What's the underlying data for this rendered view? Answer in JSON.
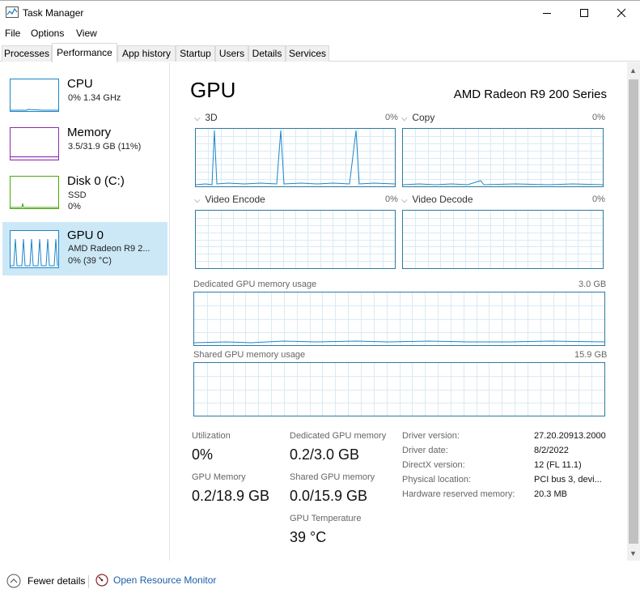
{
  "window": {
    "title": "Task Manager"
  },
  "menu": [
    "File",
    "Options",
    "View"
  ],
  "tabs": [
    "Processes",
    "Performance",
    "App history",
    "Startup",
    "Users",
    "Details",
    "Services"
  ],
  "active_tab": "Performance",
  "resources": [
    {
      "title": "CPU",
      "lines": [
        "0%  1.34 GHz"
      ],
      "color": "#1a86c8"
    },
    {
      "title": "Memory",
      "lines": [
        "3.5/31.9 GB (11%)"
      ],
      "color": "#8b2bad"
    },
    {
      "title": "Disk 0 (C:)",
      "lines": [
        "SSD",
        "0%"
      ],
      "color": "#4da60c"
    },
    {
      "title": "GPU 0",
      "lines": [
        "AMD Radeon R9 2...",
        "0%  (39 °C)"
      ],
      "color": "#1a86c8"
    }
  ],
  "gpu": {
    "title": "GPU",
    "model": "AMD Radeon R9 200 Series",
    "engines": [
      {
        "label": "3D",
        "percent": "0%"
      },
      {
        "label": "Copy",
        "percent": "0%"
      },
      {
        "label": "Video Encode",
        "percent": "0%"
      },
      {
        "label": "Video Decode",
        "percent": "0%"
      }
    ],
    "dedicated_memory_graph": {
      "label": "Dedicated GPU memory usage",
      "max": "3.0 GB"
    },
    "shared_memory_graph": {
      "label": "Shared GPU memory usage",
      "max": "15.9 GB"
    },
    "stats": {
      "utilization": {
        "label": "Utilization",
        "value": "0%"
      },
      "dedicated_memory": {
        "label": "Dedicated GPU memory",
        "value": "0.2/3.0 GB"
      },
      "gpu_memory": {
        "label": "GPU Memory",
        "value": "0.2/18.9 GB"
      },
      "shared_memory": {
        "label": "Shared GPU memory",
        "value": "0.0/15.9 GB"
      },
      "temperature": {
        "label": "GPU Temperature",
        "value": "39 °C"
      }
    },
    "info": [
      {
        "label": "Driver version:",
        "value": "27.20.20913.2000"
      },
      {
        "label": "Driver date:",
        "value": "8/2/2022"
      },
      {
        "label": "DirectX version:",
        "value": "12 (FL 11.1)"
      },
      {
        "label": "Physical location:",
        "value": "PCI bus 3, devi..."
      },
      {
        "label": "Hardware reserved memory:",
        "value": "20.3 MB"
      }
    ]
  },
  "footer": {
    "fewer_details": "Fewer details",
    "open_resource_monitor": "Open Resource Monitor"
  },
  "colors": {
    "gpu_accent": "#1a86c8",
    "memory_accent": "#8b2bad",
    "disk_accent": "#4da60c",
    "selected_bg": "#cce8f7",
    "link": "#1a5ea8"
  }
}
